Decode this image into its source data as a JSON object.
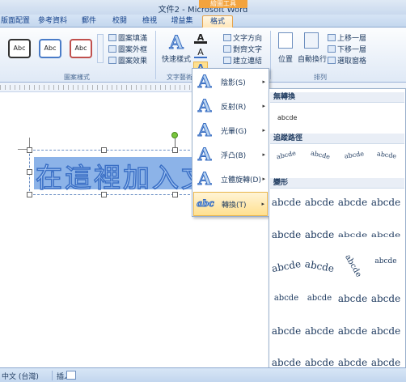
{
  "window": {
    "title": "文件2 - Microsoft Word",
    "context_tab_header": "繪圖工具"
  },
  "tabs": [
    {
      "label": "版面配置"
    },
    {
      "label": "參考資料"
    },
    {
      "label": "郵件"
    },
    {
      "label": "校閱"
    },
    {
      "label": "檢視"
    },
    {
      "label": "增益集"
    },
    {
      "label": "格式",
      "active": true
    }
  ],
  "ribbon": {
    "shape_styles": {
      "samples": [
        "Abc",
        "Abc",
        "Abc"
      ],
      "fill": "圖案填滿",
      "outline": "圖案外框",
      "effects": "圖案效果",
      "label": "圖案樣式"
    },
    "wordart": {
      "quick_styles": "快速樣式",
      "label": "文字藝術師"
    },
    "text": {
      "direction": "文字方向",
      "align": "對齊文字",
      "link": "建立連結"
    },
    "arrange": {
      "position": "位置",
      "wrap": "自動換行",
      "bring_forward": "上移一層",
      "send_backward": "下移一層",
      "selection_pane": "選取窗格",
      "label": "排列"
    }
  },
  "document": {
    "wordart_text": "在這裡加入文字"
  },
  "effects_menu": {
    "items": [
      {
        "icon": "A",
        "label": "陰影(S)"
      },
      {
        "icon": "A",
        "label": "反射(R)"
      },
      {
        "icon": "A",
        "label": "光暈(G)"
      },
      {
        "icon": "A",
        "label": "浮凸(B)"
      },
      {
        "icon": "A",
        "label": "立體旋轉(D)"
      },
      {
        "icon": "abc",
        "label": "轉換(T)"
      }
    ],
    "arrow": "▸"
  },
  "transform_panel": {
    "no_transform_header": "無轉換",
    "no_transform_sample": "abcde",
    "follow_path_header": "追蹤路徑",
    "follow_path_samples": [
      "abcde",
      "abcde",
      "abcde",
      "abcde"
    ],
    "warp_header": "變形",
    "warp_samples": [
      "abcde",
      "abcde",
      "abcde",
      "abcde",
      "abcde",
      "abcde",
      "abcde",
      "abcde",
      "abcde",
      "abcde",
      "abcde",
      "abcde",
      "abcde",
      "abcde",
      "abcde",
      "abcde",
      "abcde",
      "abcde",
      "abcde",
      "abcde",
      "abcde",
      "abcde",
      "abcde",
      "abcde"
    ]
  },
  "statusbar": {
    "language": "中文 (台灣)",
    "mode": "插入"
  },
  "colors": {
    "accent": "#f3a33d",
    "ribbon": "#dfe9f6",
    "selection": "#8cb3e8"
  }
}
